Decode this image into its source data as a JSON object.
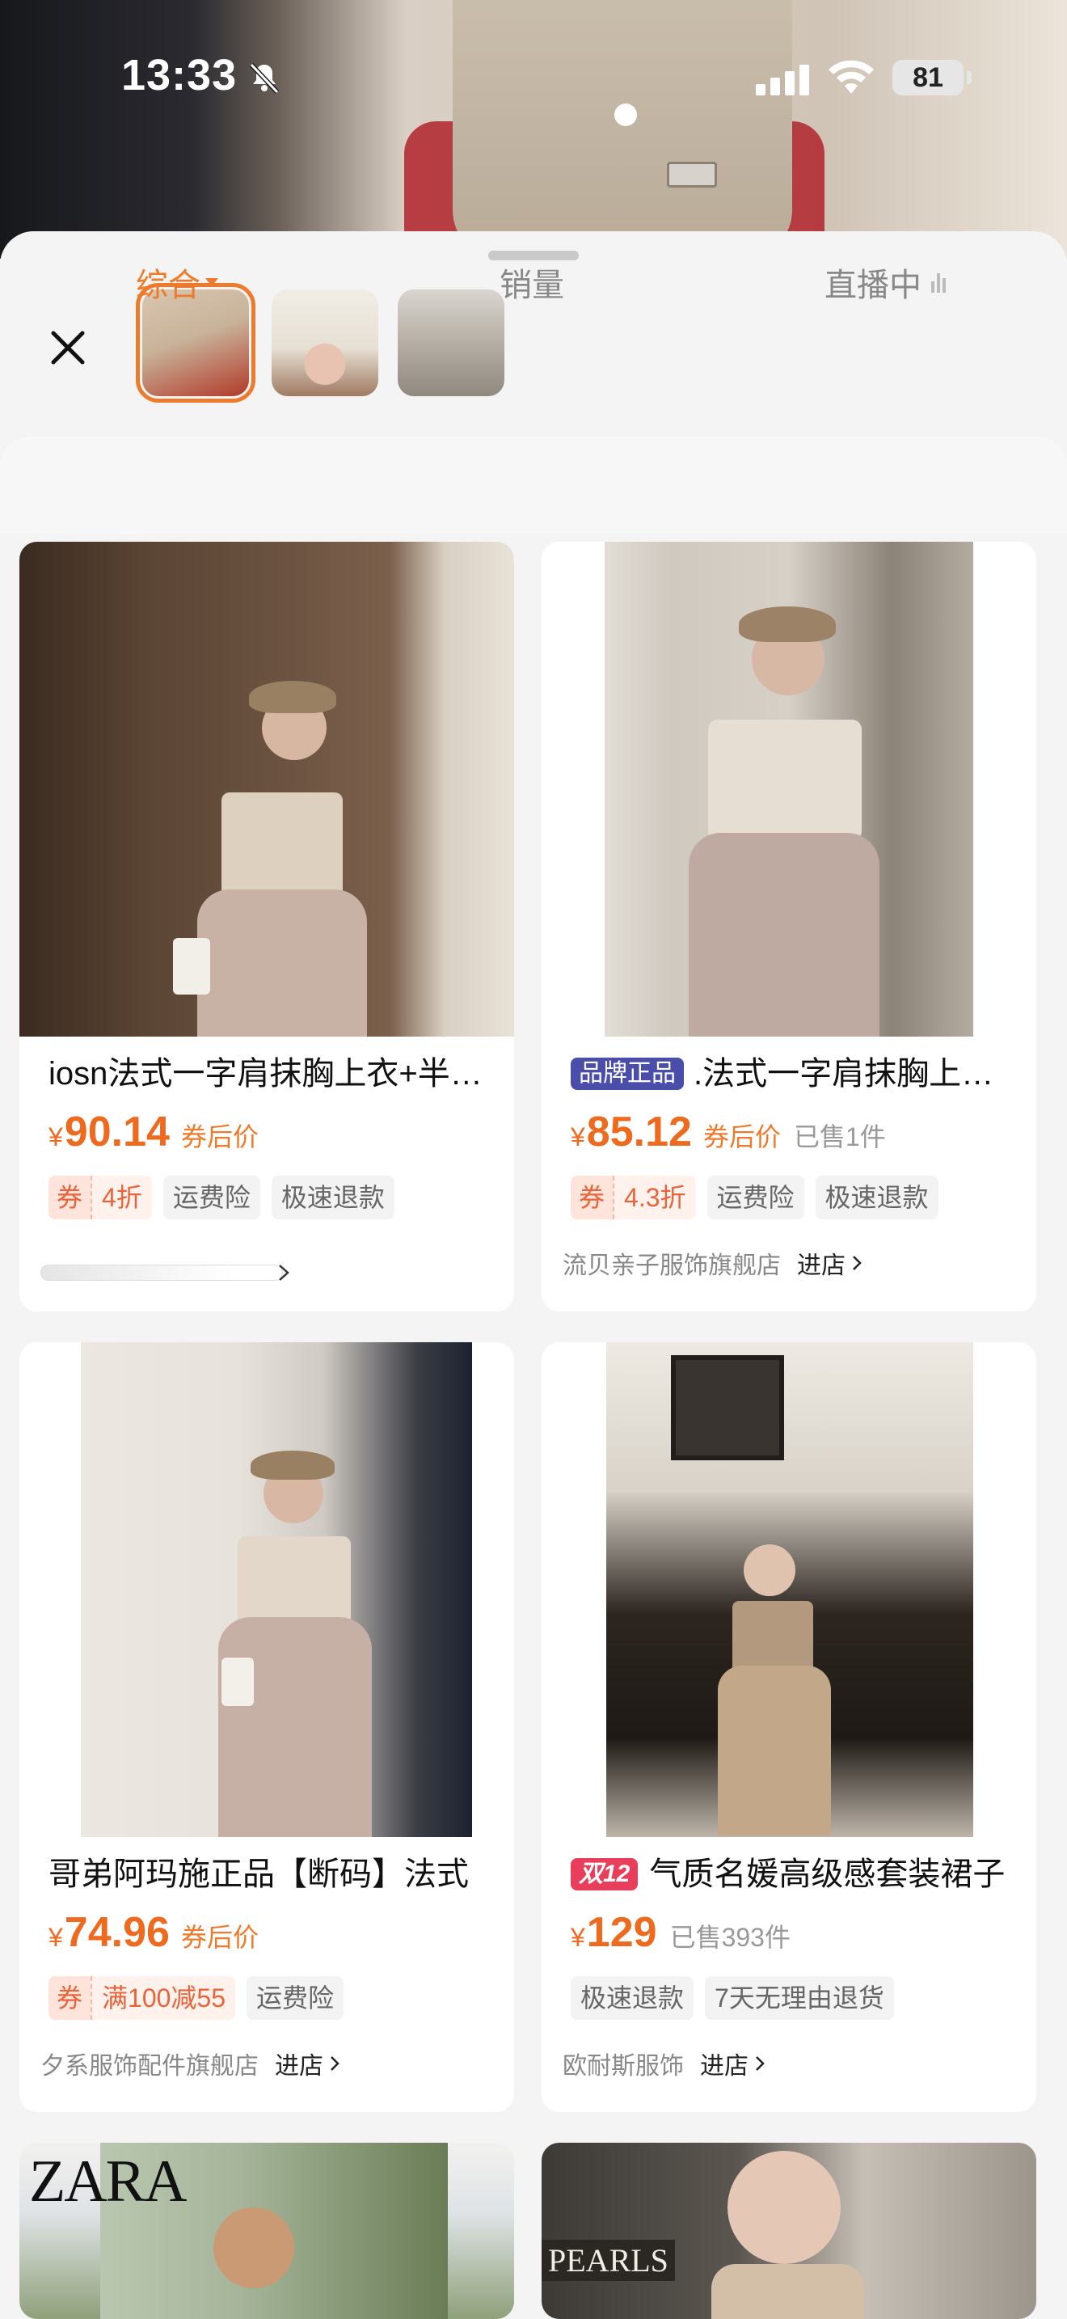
{
  "status_bar": {
    "time": "13:33",
    "battery": "81",
    "icons": [
      "bell-muted-icon",
      "signal-icon",
      "wifi-icon",
      "battery-icon"
    ]
  },
  "sheet": {
    "close_icon": "close-icon",
    "thumbnails": [
      {
        "name": "thumb-1",
        "active": true
      },
      {
        "name": "thumb-2",
        "active": false
      },
      {
        "name": "thumb-3",
        "active": false
      }
    ],
    "tabs": [
      {
        "label": "综合",
        "active": true
      },
      {
        "label": "销量",
        "active": false
      },
      {
        "label": "直播中",
        "active": false
      }
    ]
  },
  "products": [
    {
      "title": "iosn法式一字肩抹胸上衣+半身裙",
      "badge": "",
      "price_currency": "¥",
      "price": "90.14",
      "price_note": "券后价",
      "sold": "",
      "coupon": {
        "label": "券",
        "value": "4折"
      },
      "tags": [
        "运费险",
        "极速退款"
      ],
      "shop": "",
      "shop_enter": ""
    },
    {
      "title": ".法式一字肩抹胸上衣半身裙",
      "badge": "品牌正品",
      "price_currency": "¥",
      "price": "85.12",
      "price_note": "券后价",
      "sold": "已售1件",
      "coupon": {
        "label": "券",
        "value": "4.3折"
      },
      "tags": [
        "运费险",
        "极速退款"
      ],
      "shop": "流贝亲子服饰旗舰店",
      "shop_enter": "进店"
    },
    {
      "title": "哥弟阿玛施正品【断码】法式",
      "badge": "",
      "price_currency": "¥",
      "price": "74.96",
      "price_note": "券后价",
      "sold": "",
      "coupon": {
        "label": "券",
        "value": "满100减55"
      },
      "tags": [
        "运费险"
      ],
      "shop": "夕系服饰配件旗舰店",
      "shop_enter": "进店"
    },
    {
      "title": "气质名媛高级感套装裙子",
      "badge": "双12",
      "price_currency": "¥",
      "price": "129",
      "price_note": "",
      "sold": "已售393件",
      "coupon": null,
      "tags": [
        "极速退款",
        "7天无理由退货"
      ],
      "shop": "欧耐斯服饰",
      "shop_enter": "进店"
    }
  ],
  "next_row": [
    {
      "logo": "ZARA"
    },
    {
      "sign": "PEARLS"
    }
  ],
  "colors": {
    "accent": "#ee7b2c",
    "price": "#ee6a1f",
    "brand_badge": "#4a4eaa",
    "d12_badge": "#e83d5b"
  }
}
